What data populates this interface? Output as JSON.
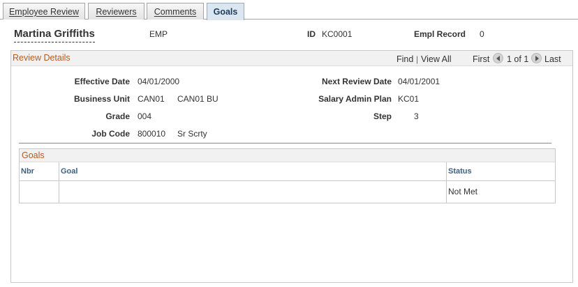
{
  "tabs": [
    {
      "label": "Employee Review",
      "active": false
    },
    {
      "label": "Reviewers",
      "active": false
    },
    {
      "label": "Comments",
      "active": false
    },
    {
      "label": "Goals",
      "active": true
    }
  ],
  "header": {
    "name": "Martina Griffiths",
    "type": "EMP",
    "id_label": "ID",
    "id_value": "KC0001",
    "empl_record_label": "Empl Record",
    "empl_record_value": "0"
  },
  "review_details": {
    "title": "Review Details",
    "find_label": "Find",
    "view_all_label": "View All",
    "first_label": "First",
    "pager": "1 of 1",
    "last_label": "Last",
    "effective_date_label": "Effective Date",
    "effective_date": "04/01/2000",
    "next_review_date_label": "Next Review Date",
    "next_review_date": "04/01/2001",
    "business_unit_label": "Business Unit",
    "business_unit": "CAN01",
    "business_unit_desc": "CAN01 BU",
    "salary_admin_plan_label": "Salary Admin Plan",
    "salary_admin_plan": "KC01",
    "grade_label": "Grade",
    "grade": "004",
    "step_label": "Step",
    "step": "3",
    "job_code_label": "Job Code",
    "job_code": "800010",
    "job_code_desc": "Sr Scrty"
  },
  "goals": {
    "title": "Goals",
    "columns": [
      "Nbr",
      "Goal",
      "Status"
    ],
    "rows": [
      {
        "nbr": "",
        "goal": "",
        "status": "Not Met"
      }
    ]
  },
  "colors": {
    "section_title": "#b35a1f",
    "column_header": "#3e5f82",
    "active_tab_bg": "#dbe6f1"
  }
}
